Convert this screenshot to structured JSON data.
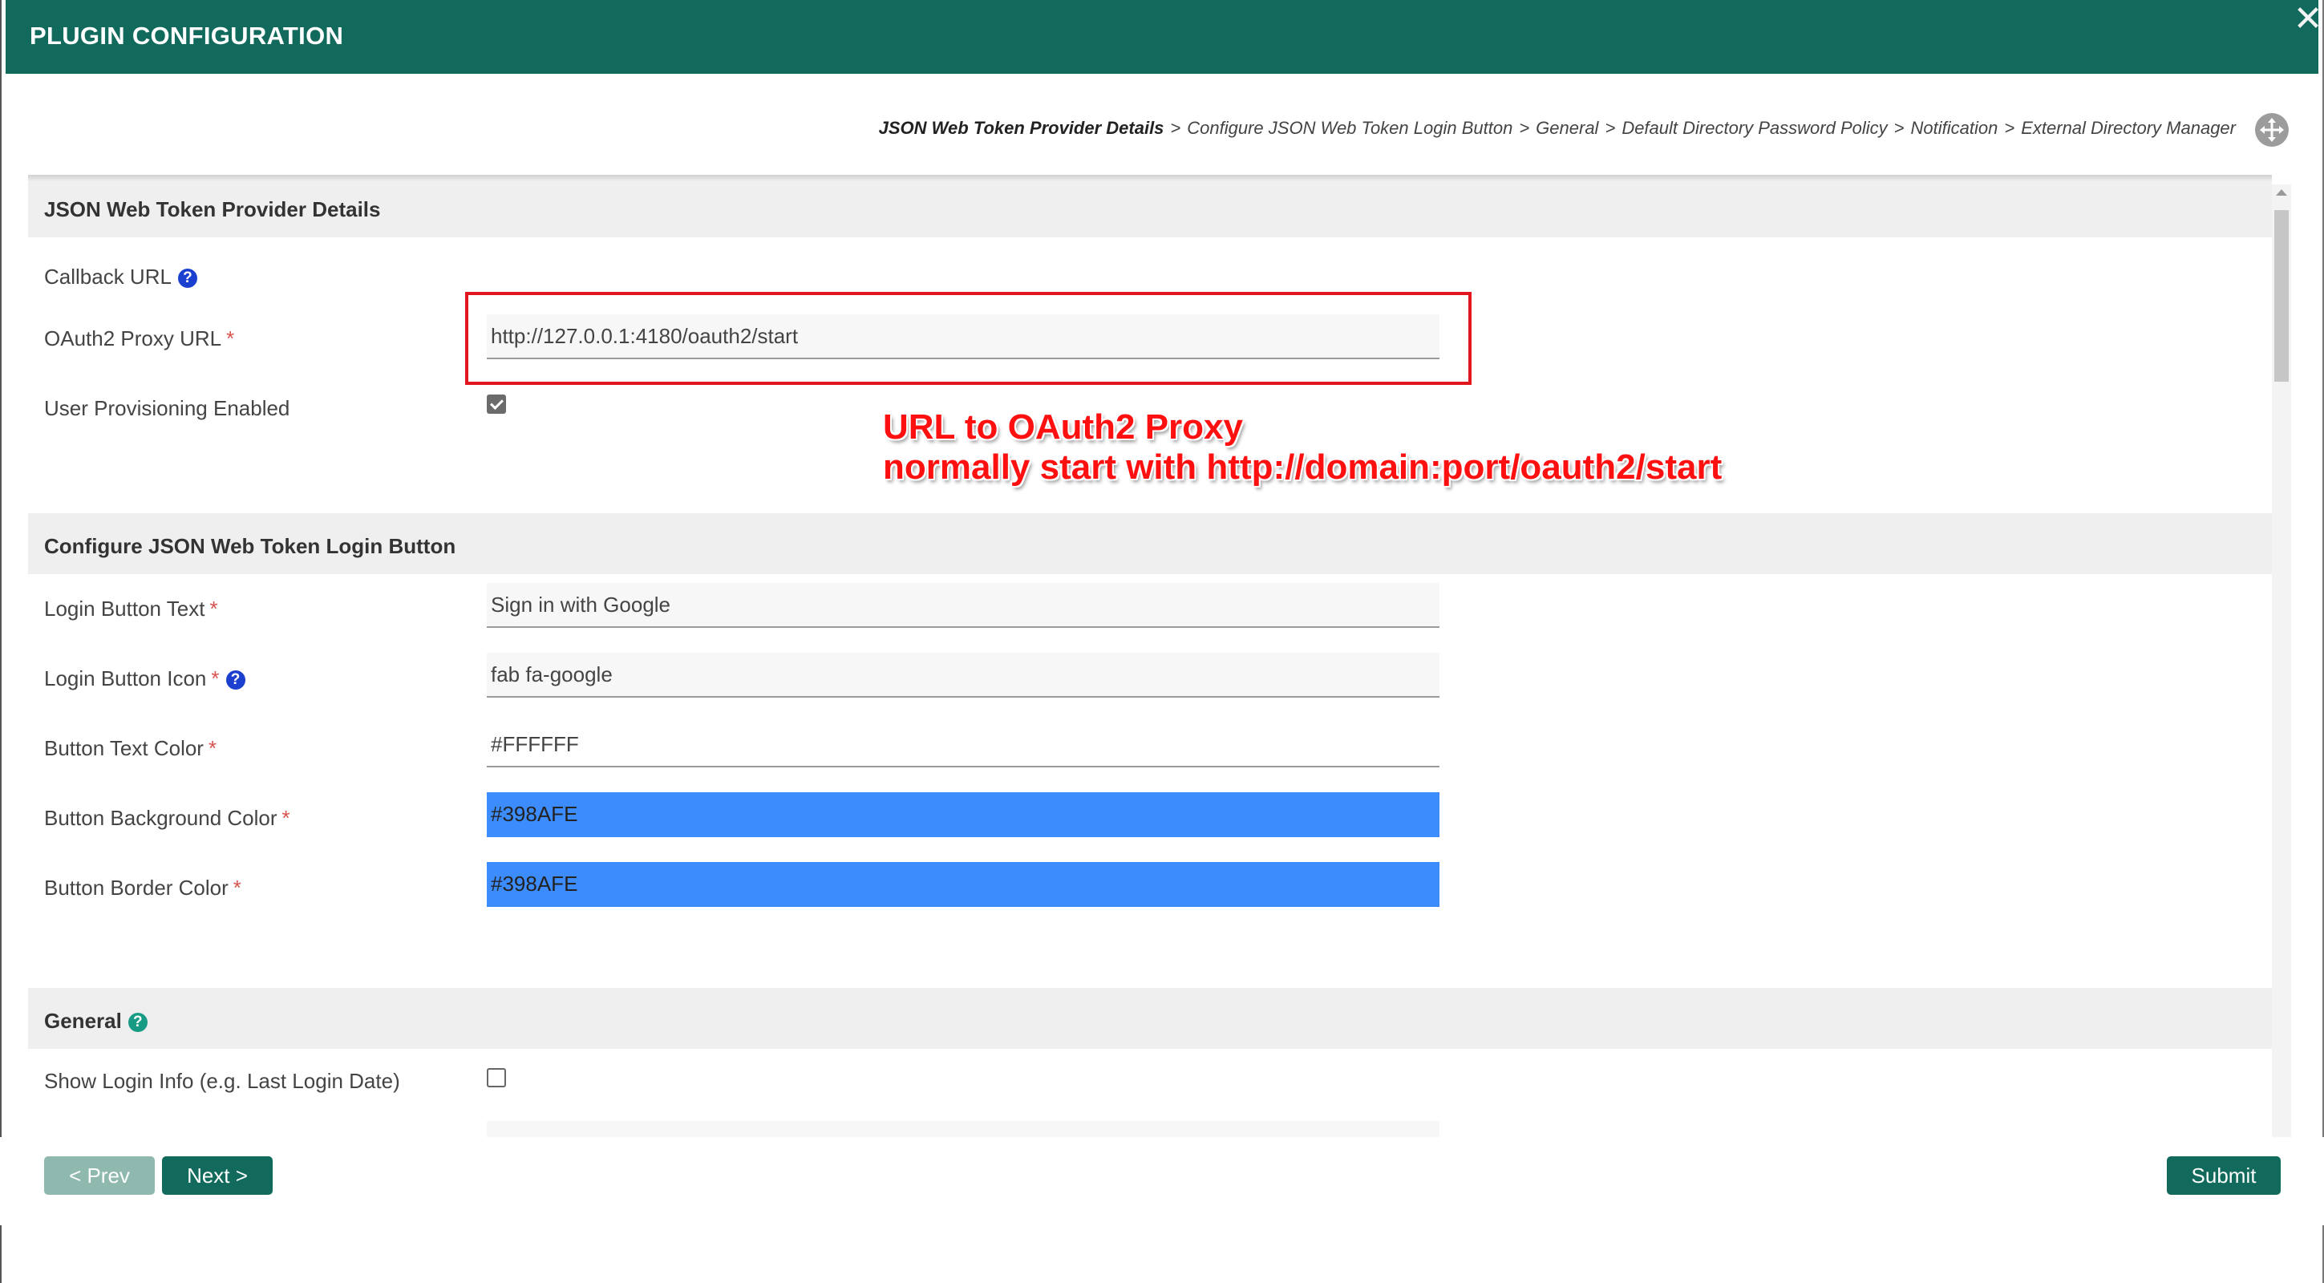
{
  "window": {
    "title": "PLUGIN CONFIGURATION",
    "close_icon": "close-icon"
  },
  "breadcrumb": {
    "items": [
      "JSON Web Token Provider Details",
      "Configure JSON Web Token Login Button",
      "General",
      "Default Directory Password Policy",
      "Notification",
      "External Directory Manager"
    ],
    "separator": ">",
    "active_index": 0,
    "expand_icon": "move-expand-icon"
  },
  "sections": {
    "provider": {
      "title": "JSON Web Token Provider Details",
      "callback_url_label": "Callback URL",
      "oauth2_proxy_url_label": "OAuth2 Proxy URL",
      "oauth2_proxy_url_value": "http://127.0.0.1:4180/oauth2/start",
      "user_provisioning_label": "User Provisioning Enabled",
      "user_provisioning_checked": true
    },
    "login_button": {
      "title": "Configure JSON Web Token Login Button",
      "text_label": "Login Button Text",
      "text_value": "Sign in with Google",
      "icon_label": "Login Button Icon",
      "icon_value": "fab fa-google",
      "text_color_label": "Button Text Color",
      "text_color_value": "#FFFFFF",
      "bg_color_label": "Button Background Color",
      "bg_color_value": "#398AFE",
      "border_color_label": "Button Border Color",
      "border_color_value": "#398AFE"
    },
    "general": {
      "title": "General",
      "show_login_info_label": "Show Login Info (e.g. Last Login Date)",
      "show_login_info_checked": false
    }
  },
  "annotation": {
    "line1": "URL to OAuth2 Proxy",
    "line2": "normally start with http://domain:port/oauth2/start"
  },
  "footer": {
    "prev_label": "< Prev",
    "next_label": "Next >",
    "submit_label": "Submit"
  },
  "colors": {
    "header_bg": "#116a5c",
    "accent_blue": "#398AFE",
    "required_star": "#d9534f",
    "annotation_red": "#ff1010"
  }
}
